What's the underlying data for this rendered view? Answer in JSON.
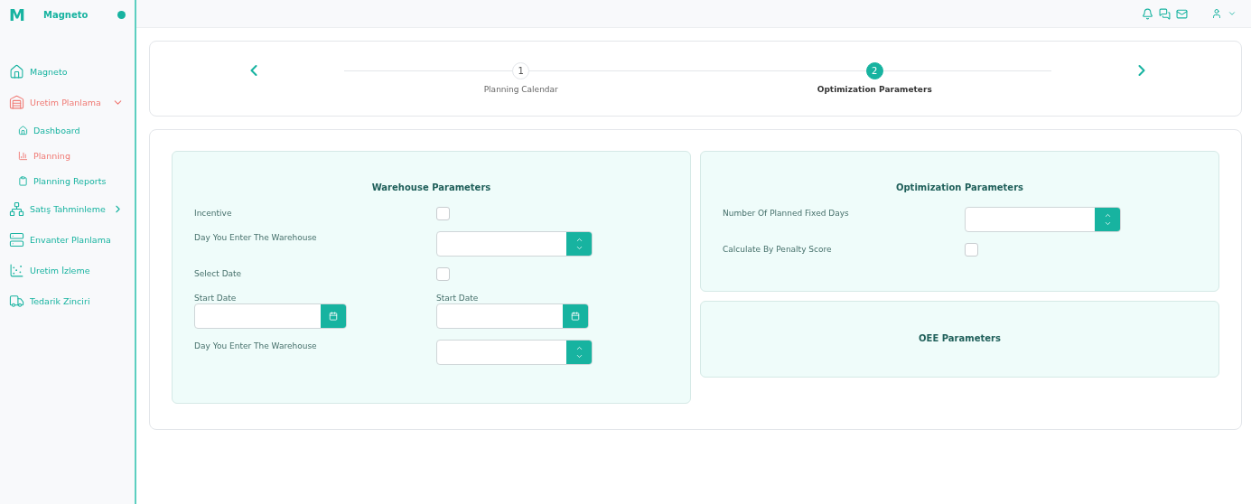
{
  "brand": {
    "letter": "M",
    "name": "Magneto",
    "online": true
  },
  "sidebar": {
    "items": [
      {
        "label": "Magneto",
        "selected": false
      },
      {
        "label": "Uretim Planlama",
        "selected": true,
        "expanded": true,
        "children": [
          {
            "label": "Dashboard",
            "selected": false
          },
          {
            "label": "Planning",
            "selected": true
          },
          {
            "label": "Planning Reports",
            "selected": false
          }
        ]
      },
      {
        "label": "Satış Tahminleme",
        "selected": false,
        "expanded": false
      },
      {
        "label": "Envanter Planlama",
        "selected": false
      },
      {
        "label": "Uretim İzleme",
        "selected": false
      },
      {
        "label": "Tedarik Zinciri",
        "selected": false
      }
    ]
  },
  "stepper": {
    "steps": [
      {
        "number": "1",
        "label": "Planning Calendar",
        "selected": false
      },
      {
        "number": "2",
        "label": "Optimization Parameters",
        "selected": true
      }
    ]
  },
  "warehouse": {
    "title": "Warehouse Parameters",
    "rows": [
      {
        "kind": "checkbox",
        "label": "Incentive",
        "checked": false
      },
      {
        "kind": "number",
        "label": "Day You Enter The Warehouse"
      },
      {
        "kind": "checkbox",
        "label": "Select Date",
        "checked": false
      },
      {
        "kind": "dates",
        "dates": [
          {
            "label": "Start Date"
          },
          {
            "label": "Start Date"
          }
        ]
      },
      {
        "kind": "number",
        "label": "Day You Enter The Warehouse"
      }
    ]
  },
  "optimization": {
    "title": "Optimization Parameters",
    "rows": [
      {
        "kind": "number",
        "label": "Number Of Planned Fixed Days"
      },
      {
        "kind": "checkbox",
        "label": "Calculate By Penalty Score",
        "checked": false
      }
    ]
  },
  "oee": {
    "title": "OEE Parameters"
  }
}
